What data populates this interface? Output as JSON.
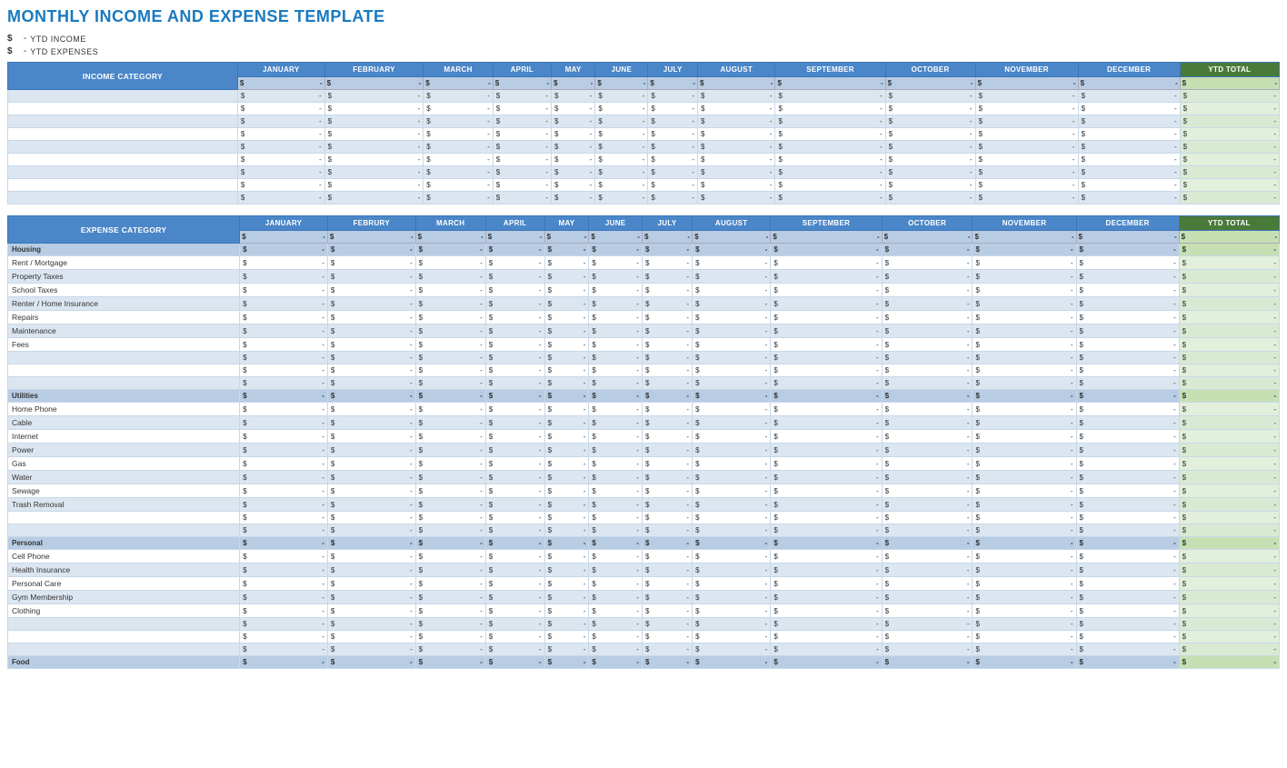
{
  "title": "MONTHLY INCOME AND EXPENSE TEMPLATE",
  "ytd": {
    "income_label": "YTD INCOME",
    "expense_label": "YTD EXPENSES",
    "dollar": "$",
    "dash": "-"
  },
  "months": [
    "JANUARY",
    "FEBRUARY",
    "MARCH",
    "APRIL",
    "MAY",
    "JUNE",
    "JULY",
    "AUGUST",
    "SEPTEMBER",
    "OCTOBER",
    "NOVEMBER",
    "DECEMBER"
  ],
  "months_expense": [
    "JANUARY",
    "FEBRURY",
    "MARCH",
    "APRIL",
    "MAY",
    "JUNE",
    "JULY",
    "AUGUST",
    "SEPTEMBER",
    "OCTOBER",
    "NOVEMBER",
    "DECEMBER"
  ],
  "ytd_total": "YTD TOTAL",
  "income_category": "INCOME CATEGORY",
  "expense_category": "EXPENSE CATEGORY",
  "income_rows": [
    {
      "category": "",
      "values": [
        "-",
        "-",
        "-",
        "-",
        "-",
        "-",
        "-",
        "-",
        "-",
        "-",
        "-",
        "-"
      ],
      "ytd": "-"
    },
    {
      "category": "",
      "values": [
        "-",
        "-",
        "-",
        "-",
        "-",
        "-",
        "-",
        "-",
        "-",
        "-",
        "-",
        "-"
      ],
      "ytd": "-"
    },
    {
      "category": "",
      "values": [
        "-",
        "-",
        "-",
        "-",
        "-",
        "-",
        "-",
        "-",
        "-",
        "-",
        "-",
        "-"
      ],
      "ytd": "-"
    },
    {
      "category": "",
      "values": [
        "-",
        "-",
        "-",
        "-",
        "-",
        "-",
        "-",
        "-",
        "-",
        "-",
        "-",
        "-"
      ],
      "ytd": "-"
    },
    {
      "category": "",
      "values": [
        "-",
        "-",
        "-",
        "-",
        "-",
        "-",
        "-",
        "-",
        "-",
        "-",
        "-",
        "-"
      ],
      "ytd": "-"
    },
    {
      "category": "",
      "values": [
        "-",
        "-",
        "-",
        "-",
        "-",
        "-",
        "-",
        "-",
        "-",
        "-",
        "-",
        "-"
      ],
      "ytd": "-"
    },
    {
      "category": "",
      "values": [
        "-",
        "-",
        "-",
        "-",
        "-",
        "-",
        "-",
        "-",
        "-",
        "-",
        "-",
        "-"
      ],
      "ytd": "-"
    },
    {
      "category": "",
      "values": [
        "-",
        "-",
        "-",
        "-",
        "-",
        "-",
        "-",
        "-",
        "-",
        "-",
        "-",
        "-"
      ],
      "ytd": "-"
    },
    {
      "category": "",
      "values": [
        "-",
        "-",
        "-",
        "-",
        "-",
        "-",
        "-",
        "-",
        "-",
        "-",
        "-",
        "-"
      ],
      "ytd": "-"
    }
  ],
  "expense_sections": [
    {
      "name": "Housing",
      "is_section": true,
      "items": [
        {
          "category": "Rent / Mortgage",
          "bold": false
        },
        {
          "category": "Property Taxes",
          "bold": false
        },
        {
          "category": "School Taxes",
          "bold": false
        },
        {
          "category": "Renter / Home Insurance",
          "bold": false
        },
        {
          "category": "Repairs",
          "bold": false
        },
        {
          "category": "Maintenance",
          "bold": false
        },
        {
          "category": "Fees",
          "bold": false
        },
        {
          "category": "",
          "bold": false
        },
        {
          "category": "",
          "bold": false
        },
        {
          "category": "",
          "bold": false
        }
      ]
    },
    {
      "name": "Utilities",
      "is_section": true,
      "items": [
        {
          "category": "Home Phone",
          "bold": false
        },
        {
          "category": "Cable",
          "bold": false
        },
        {
          "category": "Internet",
          "bold": false
        },
        {
          "category": "Power",
          "bold": false
        },
        {
          "category": "Gas",
          "bold": false
        },
        {
          "category": "Water",
          "bold": false
        },
        {
          "category": "Sewage",
          "bold": false
        },
        {
          "category": "Trash Removal",
          "bold": false
        },
        {
          "category": "",
          "bold": false
        },
        {
          "category": "",
          "bold": false
        }
      ]
    },
    {
      "name": "Personal",
      "is_section": true,
      "items": [
        {
          "category": "Cell Phone",
          "bold": false
        },
        {
          "category": "Health Insurance",
          "bold": false
        },
        {
          "category": "Personal Care",
          "bold": false
        },
        {
          "category": "Gym Membership",
          "bold": false
        },
        {
          "category": "Clothing",
          "bold": false
        },
        {
          "category": "",
          "bold": false
        },
        {
          "category": "",
          "bold": false
        },
        {
          "category": "",
          "bold": false
        }
      ]
    },
    {
      "name": "Food",
      "is_section": true,
      "items": []
    }
  ]
}
